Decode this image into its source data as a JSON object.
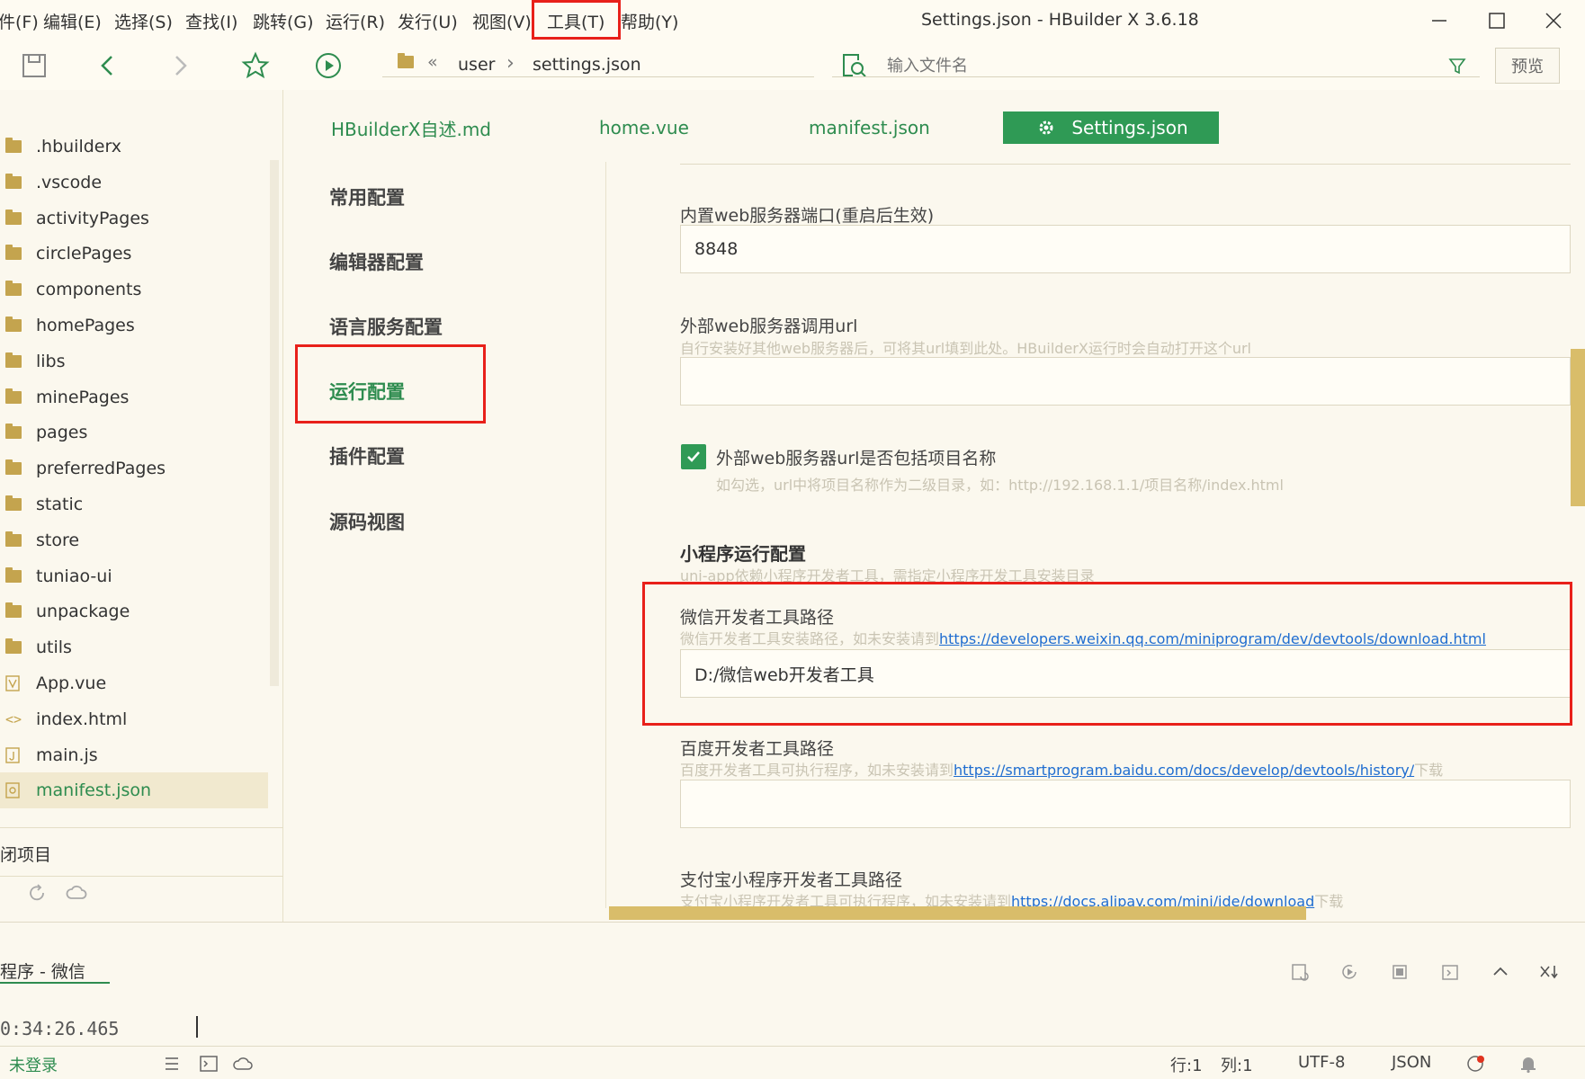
{
  "menu": {
    "items": [
      "件(F)",
      "编辑(E)",
      "选择(S)",
      "查找(I)",
      "跳转(G)",
      "运行(R)",
      "发行(U)",
      "视图(V)",
      "工具(T)",
      "帮助(Y)"
    ]
  },
  "window": {
    "title": "Settings.json - HBuilder X 3.6.18"
  },
  "toolbar": {
    "breadcrumb": {
      "back_glyph": "«",
      "folder": "user",
      "sep": "›",
      "file": "settings.json"
    },
    "search_placeholder": "输入文件名",
    "preview_label": "预览"
  },
  "sidebar": {
    "items": [
      {
        "label": ".hbuilderx",
        "type": "folder"
      },
      {
        "label": ".vscode",
        "type": "folder"
      },
      {
        "label": "activityPages",
        "type": "folder"
      },
      {
        "label": "circlePages",
        "type": "folder"
      },
      {
        "label": "components",
        "type": "folder"
      },
      {
        "label": "homePages",
        "type": "folder"
      },
      {
        "label": "libs",
        "type": "folder"
      },
      {
        "label": "minePages",
        "type": "folder"
      },
      {
        "label": "pages",
        "type": "folder"
      },
      {
        "label": "preferredPages",
        "type": "folder"
      },
      {
        "label": "static",
        "type": "folder"
      },
      {
        "label": "store",
        "type": "folder"
      },
      {
        "label": "tuniao-ui",
        "type": "folder"
      },
      {
        "label": "unpackage",
        "type": "folder"
      },
      {
        "label": "utils",
        "type": "folder"
      },
      {
        "label": "App.vue",
        "type": "vue-file"
      },
      {
        "label": "index.html",
        "type": "html-file"
      },
      {
        "label": "main.js",
        "type": "js-file"
      },
      {
        "label": "manifest.json",
        "type": "json-file"
      }
    ],
    "close_project": "闭项目"
  },
  "tabs": [
    {
      "label": "HBuilderX自述.md"
    },
    {
      "label": "home.vue"
    },
    {
      "label": "manifest.json"
    },
    {
      "label": "Settings.json"
    }
  ],
  "settings_nav": [
    "常用配置",
    "编辑器配置",
    "语言服务配置",
    "运行配置",
    "插件配置",
    "源码视图"
  ],
  "settings": {
    "port_label": "内置web服务器端口(重启后生效)",
    "port_value": "8848",
    "ext_url_label": "外部web服务器调用url",
    "ext_url_desc": "自行安装好其他web服务器后，可将其url填到此处。HBuilderX运行时会自动打开这个url",
    "ext_url_value": "",
    "include_name_label": "外部web服务器url是否包括项目名称",
    "include_name_desc": "如勾选，url中将项目名称作为二级目录，如：http://192.168.1.1/项目名称/index.html",
    "mp_section_title": "小程序运行配置",
    "mp_section_desc": "uni-app依赖小程序开发者工具，需指定小程序开发工具安装目录",
    "wechat_label": "微信开发者工具路径",
    "wechat_desc_prefix": "微信开发者工具安装路径，如未安装请到",
    "wechat_link": "https://developers.weixin.qq.com/miniprogram/dev/devtools/download.html",
    "wechat_value": "D:/微信web开发者工具",
    "baidu_label": "百度开发者工具路径",
    "baidu_desc_prefix": "百度开发者工具可执行程序，如未安装请到",
    "baidu_link": "https://smartprogram.baidu.com/docs/develop/devtools/history/",
    "baidu_desc_suffix": "下载",
    "baidu_value": "",
    "alipay_label": "支付宝小程序开发者工具路径",
    "alipay_desc_prefix": "支付宝小程序开发者工具可执行程序，如未安装请到",
    "alipay_link": "https://docs.alipay.com/mini/ide/download",
    "alipay_desc_suffix": "下载"
  },
  "console": {
    "tab_label": "程序 - 微信",
    "log_line": "0:34:26.465"
  },
  "statusbar": {
    "login": "未登录",
    "row": "行:1",
    "col": "列:1",
    "encoding": "UTF-8",
    "language": "JSON"
  },
  "colors": {
    "accent_green": "#2f9a55",
    "link_blue": "#1f6dd0",
    "highlight_red": "#e8201a",
    "background": "#fbf8ee"
  }
}
